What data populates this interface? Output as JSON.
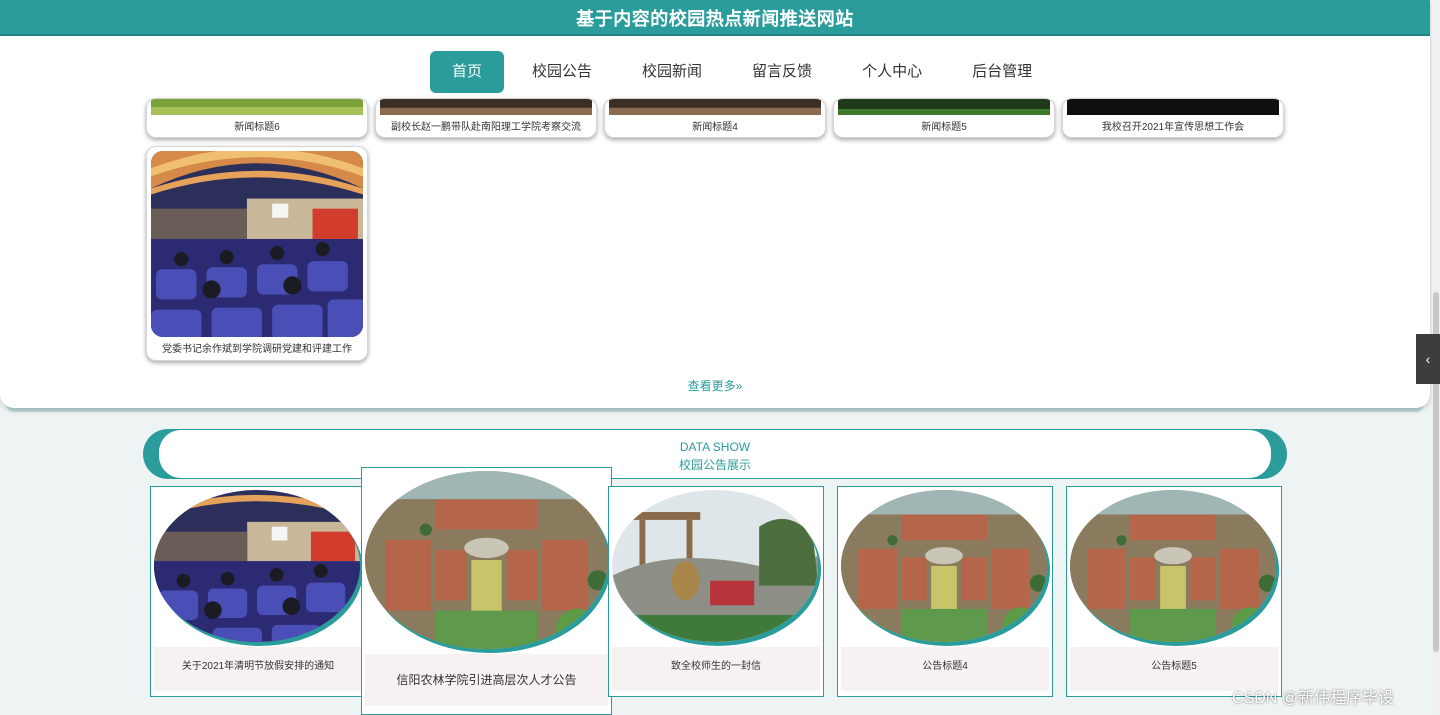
{
  "header": {
    "title": "基于内容的校园热点新闻推送网站"
  },
  "nav": {
    "items": [
      {
        "label": "首页"
      },
      {
        "label": "校园公告"
      },
      {
        "label": "校园新闻"
      },
      {
        "label": "留言反馈"
      },
      {
        "label": "个人中心"
      },
      {
        "label": "后台管理"
      }
    ]
  },
  "news": {
    "top_row": [
      {
        "title": "新闻标题6"
      },
      {
        "title": "副校长赵一鹏带队赴南阳理工学院考察交流"
      },
      {
        "title": "新闻标题4"
      },
      {
        "title": "新闻标题5"
      },
      {
        "title": "我校召开2021年宣传思想工作会"
      }
    ],
    "second_row": [
      {
        "title": "党委书记余作斌到学院调研党建和评建工作"
      }
    ],
    "more_label": "查看更多»"
  },
  "notice_section": {
    "en_title": "DATA SHOW",
    "cn_title": "校园公告展示",
    "items": [
      {
        "title": "关于2021年清明节放假安排的通知",
        "image": "auditorium"
      },
      {
        "title": "信阳农林学院引进高层次人才公告",
        "image": "campus"
      },
      {
        "title": "致全校师生的一封信",
        "image": "sculpture"
      },
      {
        "title": "公告标题4",
        "image": "campus"
      },
      {
        "title": "公告标题5",
        "image": "campus"
      }
    ]
  },
  "side_tab": {
    "icon": "chevron-left-icon",
    "glyph": "‹"
  },
  "watermark": "CSDN @新伟程序毕设",
  "colors": {
    "accent": "#2a9c9c",
    "accent_dark": "#238585"
  }
}
